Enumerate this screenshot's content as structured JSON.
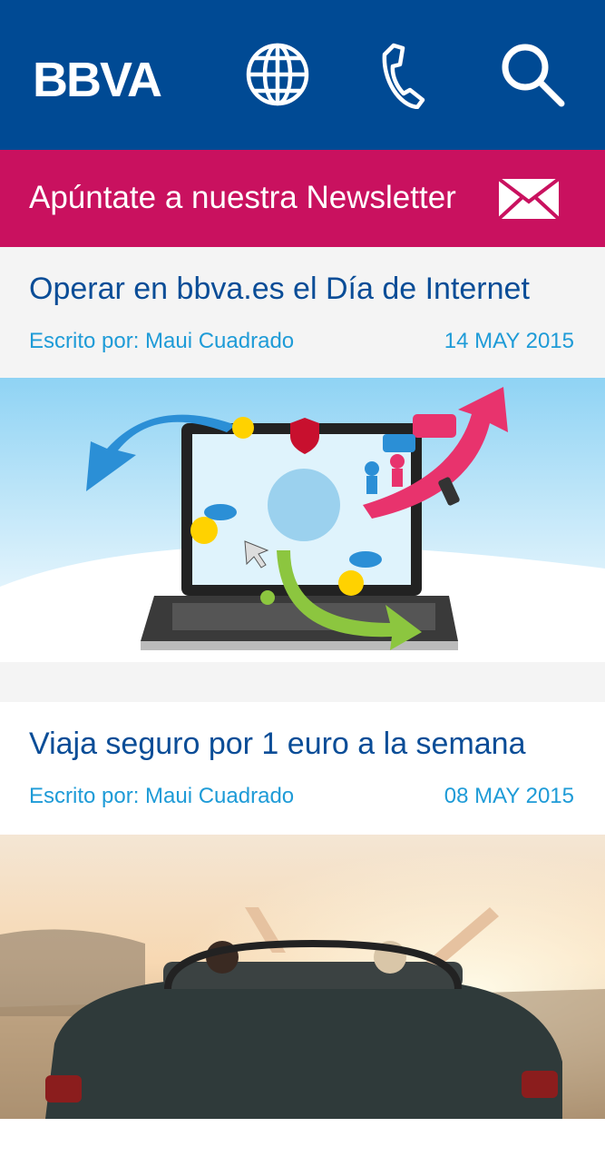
{
  "header": {
    "logo": "BBVA",
    "icons": [
      "globe-icon",
      "phone-icon",
      "search-icon"
    ]
  },
  "newsletter": {
    "label": "Apúntate a nuestra Newsletter",
    "icon": "mail-icon"
  },
  "articles": [
    {
      "title": "Operar en bbva.es el Día de Internet",
      "author": "Escrito por: Maui Cuadrado",
      "date": "14 MAY 2015"
    },
    {
      "title": "Viaja seguro por 1 euro a la semana",
      "author": "Escrito por: Maui Cuadrado",
      "date": "08 MAY 2015"
    }
  ],
  "colors": {
    "header": "#004a94",
    "newsletter": "#c9115f",
    "title": "#0a4d97",
    "meta": "#1e9bd7"
  }
}
